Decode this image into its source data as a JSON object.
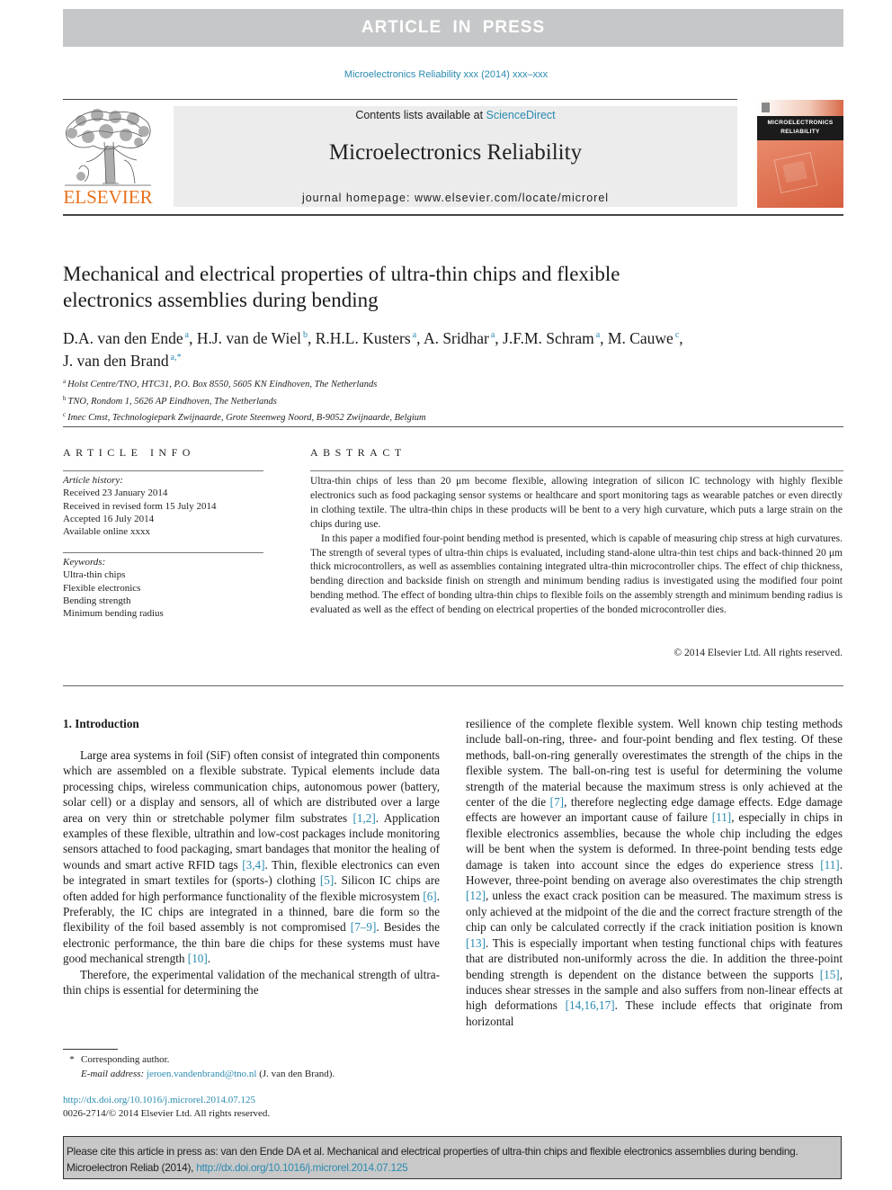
{
  "banner": {
    "label": "ARTICLE IN PRESS"
  },
  "journal_ref": "Microelectronics Reliability xxx (2014) xxx–xxx",
  "publisher": {
    "logo_text": "ELSEVIER",
    "logo_color": "#e9711c"
  },
  "masthead": {
    "contents_prefix": "Contents lists available at ",
    "contents_link": "ScienceDirect",
    "journal_title": "Microelectronics Reliability",
    "homepage_prefix": "journal homepage: ",
    "homepage_url": "www.elsevier.com/locate/microrel"
  },
  "cover": {
    "line1": "MICROELECTRONICS",
    "line2": "RELIABILITY"
  },
  "article": {
    "title_line1": "Mechanical and electrical properties of ultra-thin chips and flexible",
    "title_line2": "electronics assemblies during bending",
    "authors": [
      {
        "name": "D.A. van den Ende",
        "sup": "a",
        "sep": ", "
      },
      {
        "name": "H.J. van de Wiel",
        "sup": "b",
        "sep": ", "
      },
      {
        "name": "R.H.L. Kusters",
        "sup": "a",
        "sep": ", "
      },
      {
        "name": "A. Sridhar",
        "sup": "a",
        "sep": ", "
      },
      {
        "name": "J.F.M. Schram",
        "sup": "a",
        "sep": ", "
      },
      {
        "name": "M. Cauwe",
        "sup": "c",
        "sep": ","
      },
      {
        "name": "J. van den Brand",
        "sup": "a,*",
        "sep": ""
      }
    ],
    "affiliations": [
      {
        "mark": "a",
        "text": "Holst Centre/TNO, HTC31, P.O. Box 8550, 5605 KN Eindhoven, The Netherlands"
      },
      {
        "mark": "b",
        "text": "TNO, Rondom 1, 5626 AP Eindhoven, The Netherlands"
      },
      {
        "mark": "c",
        "text": "Imec Cmst, Technologiepark Zwijnaarde, Grote Steenweg Noord, B-9052 Zwijnaarde, Belgium"
      }
    ]
  },
  "article_info": {
    "heading": "ARTICLE INFO",
    "history_label": "Article history:",
    "history": [
      "Received 23 January 2014",
      "Received in revised form 15 July 2014",
      "Accepted 16 July 2014",
      "Available online xxxx"
    ],
    "keywords_label": "Keywords:",
    "keywords": [
      "Ultra-thin chips",
      "Flexible electronics",
      "Bending strength",
      "Minimum bending radius"
    ]
  },
  "abstract": {
    "heading": "ABSTRACT",
    "p1": "Ultra-thin chips of less than 20 μm become flexible, allowing integration of silicon IC technology with highly flexible electronics such as food packaging sensor systems or healthcare and sport monitoring tags as wearable patches or even directly in clothing textile. The ultra-thin chips in these products will be bent to a very high curvature, which puts a large strain on the chips during use.",
    "p2": "In this paper a modified four-point bending method is presented, which is capable of measuring chip stress at high curvatures. The strength of several types of ultra-thin chips is evaluated, including stand-alone ultra-thin test chips and back-thinned 20 μm thick microcontrollers, as well as assemblies containing integrated ultra-thin microcontroller chips. The effect of chip thickness, bending direction and backside finish on strength and minimum bending radius is investigated using the modified four point bending method. The effect of bonding ultra-thin chips to flexible foils on the assembly strength and minimum bending radius is evaluated as well as the effect of bending on electrical properties of the bonded microcontroller dies.",
    "copyright": "© 2014 Elsevier Ltd. All rights reserved."
  },
  "intro": {
    "heading": "1. Introduction",
    "left_p1": [
      {
        "t": "Large area systems in foil (SiF) often consist of integrated thin components which are assembled on a flexible substrate. Typical elements include data processing chips, wireless communication chips, autonomous power (battery, solar cell) or a display and sensors, all of which are distributed over a large area on very thin or stretchable polymer film substrates "
      },
      {
        "c": "[1,2]"
      },
      {
        "t": ". Application examples of these flexible, ultrathin and low-cost packages include monitoring sensors attached to food packaging, smart bandages that monitor the healing of wounds and smart active RFID tags "
      },
      {
        "c": "[3,4]"
      },
      {
        "t": ". Thin, flexible electronics can even be integrated in smart textiles for (sports-) clothing "
      },
      {
        "c": "[5]"
      },
      {
        "t": ". Silicon IC chips are often added for high performance functionality of the flexible microsystem "
      },
      {
        "c": "[6]"
      },
      {
        "t": ". Preferably, the IC chips are integrated in a thinned, bare die form so the flexibility of the foil based assembly is not compromised "
      },
      {
        "c": "[7–9]"
      },
      {
        "t": ". Besides the electronic performance, the thin bare die chips for these systems must have good mechanical strength "
      },
      {
        "c": "[10]"
      },
      {
        "t": "."
      }
    ],
    "left_p2": "Therefore, the experimental validation of the mechanical strength of ultra-thin chips is essential for determining the",
    "right_p1": [
      {
        "t": "resilience of the complete flexible system. Well known chip testing methods include ball-on-ring, three- and four-point bending and flex testing. Of these methods, ball-on-ring generally overestimates the strength of the chips in the flexible system. The ball-on-ring test is useful for determining the volume strength of the material because the maximum stress is only achieved at the center of the die "
      },
      {
        "c": "[7]"
      },
      {
        "t": ", therefore neglecting edge damage effects. Edge damage effects are however an important cause of failure "
      },
      {
        "c": "[11]"
      },
      {
        "t": ", especially in chips in flexible electronics assemblies, because the whole chip including the edges will be bent when the system is deformed. In three-point bending tests edge damage is taken into account since the edges do experience stress "
      },
      {
        "c": "[11]"
      },
      {
        "t": ". However, three-point bending on average also overestimates the chip strength "
      },
      {
        "c": "[12]"
      },
      {
        "t": ", unless the exact crack position can be measured. The maximum stress is only achieved at the midpoint of the die and the correct fracture strength of the chip can only be calculated correctly if the crack initiation position is known "
      },
      {
        "c": "[13]"
      },
      {
        "t": ". This is especially important when testing functional chips with features that are distributed non-uniformly across the die. In addition the three-point bending strength is dependent on the distance between the supports "
      },
      {
        "c": "[15]"
      },
      {
        "t": ", induces shear stresses in the sample and also suffers from non-linear effects at high deformations "
      },
      {
        "c": "[14,16,17]"
      },
      {
        "t": ". These include effects that originate from horizontal"
      }
    ]
  },
  "footnote": {
    "star": "*",
    "corresponding": "Corresponding author.",
    "email_label": "E-mail address: ",
    "email": "jeroen.vandenbrand@tno.nl",
    "email_suffix": " (J. van den Brand)."
  },
  "doi": {
    "url": "http://dx.doi.org/10.1016/j.microrel.2014.07.125",
    "issn_line": "0026-2714/© 2014 Elsevier Ltd. All rights reserved."
  },
  "cite_box": {
    "text": "Please cite this article in press as: van den Ende DA et al. Mechanical and electrical properties of ultra-thin chips and flexible electronics assemblies during bending. Microelectron Reliab (2014), ",
    "link": "http://dx.doi.org/10.1016/j.microrel.2014.07.125"
  }
}
